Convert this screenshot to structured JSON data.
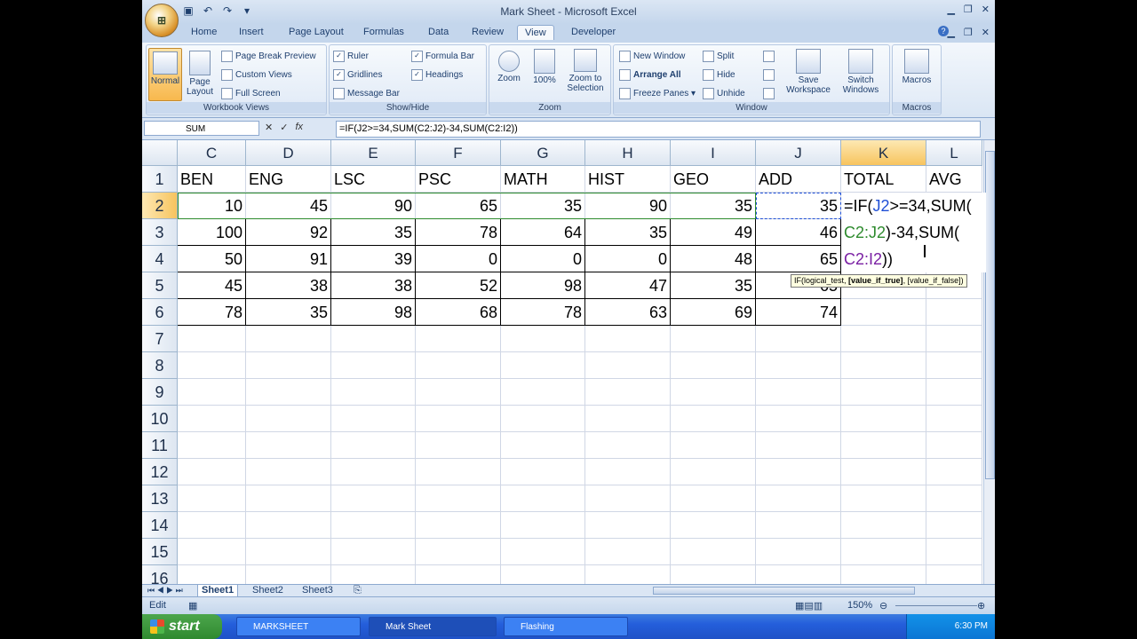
{
  "window": {
    "title": "Mark Sheet - Microsoft Excel",
    "qat_icons": [
      "save-icon",
      "undo-icon",
      "redo-icon",
      "customize-qat-icon"
    ],
    "controls": [
      "minimize",
      "restore",
      "close"
    ]
  },
  "tabs": [
    "Home",
    "Insert",
    "Page Layout",
    "Formulas",
    "Data",
    "Review",
    "View",
    "Developer"
  ],
  "active_tab": "View",
  "ribbon": {
    "workbook_views": {
      "label": "Workbook Views",
      "normal": "Normal",
      "page_layout": "Page Layout",
      "page_break_preview": "Page Break Preview",
      "custom_views": "Custom Views",
      "full_screen": "Full Screen"
    },
    "show_hide": {
      "label": "Show/Hide",
      "ruler": "Ruler",
      "gridlines": "Gridlines",
      "message_bar": "Message Bar",
      "formula_bar": "Formula Bar",
      "headings": "Headings",
      "ruler_checked": true,
      "gridlines_checked": true,
      "message_bar_checked": false,
      "formula_bar_checked": true,
      "headings_checked": true
    },
    "zoom": {
      "label": "Zoom",
      "zoom": "Zoom",
      "hundred": "100%",
      "zoom_to_selection": "Zoom to Selection"
    },
    "window": {
      "label": "Window",
      "new_window": "New Window",
      "arrange_all": "Arrange All",
      "freeze_panes": "Freeze Panes",
      "split": "Split",
      "hide": "Hide",
      "unhide": "Unhide",
      "save_workspace": "Save Workspace",
      "switch_windows": "Switch Windows"
    },
    "macros": {
      "label": "Macros",
      "macros": "Macros"
    }
  },
  "formula_bar": {
    "name_box": "SUM",
    "formula": "=IF(J2>=34,SUM(C2:J2)-34,SUM(C2:I2))"
  },
  "columns": [
    "C",
    "D",
    "E",
    "F",
    "G",
    "H",
    "I",
    "J",
    "K",
    "L"
  ],
  "selected_column": "K",
  "selected_row": "2",
  "rows": [
    "1",
    "2",
    "3",
    "4",
    "5",
    "6",
    "7",
    "8",
    "9",
    "10",
    "11",
    "12",
    "13",
    "14",
    "15",
    "16"
  ],
  "headers": [
    "BEN",
    "ENG",
    "LSC",
    "PSC",
    "MATH",
    "HIST",
    "GEO",
    "ADD",
    "TOTAL",
    "AVG"
  ],
  "data": [
    [
      "10",
      "45",
      "90",
      "65",
      "35",
      "90",
      "35",
      "35"
    ],
    [
      "100",
      "92",
      "35",
      "78",
      "64",
      "35",
      "49",
      "46"
    ],
    [
      "50",
      "91",
      "39",
      "0",
      "0",
      "0",
      "48",
      "65"
    ],
    [
      "45",
      "38",
      "38",
      "52",
      "98",
      "47",
      "35",
      "65"
    ],
    [
      "78",
      "35",
      "98",
      "68",
      "78",
      "63",
      "69",
      "74"
    ]
  ],
  "edit_cell": {
    "line1_prefix": "=IF(",
    "line1_ref": "J2",
    "line1_rest": ">=34,SUM(",
    "line2_ref": "C2:J2",
    "line2_rest": ")-34,SUM(",
    "line3_ref": "C2:I2",
    "line3_rest": "))",
    "colors": {
      "ref1": "#1f4fd6",
      "ref2": "#2e8b2e",
      "ref3": "#7a1fa3"
    }
  },
  "tooltip": {
    "fn": "IF(logical_test, ",
    "bold": "[value_if_true]",
    "rest": ", [value_if_false])"
  },
  "sheets": [
    "Sheet1",
    "Sheet2",
    "Sheet3"
  ],
  "active_sheet": "Sheet1",
  "status": {
    "mode": "Edit",
    "zoom": "150%"
  },
  "taskbar": {
    "start": "start",
    "tasks": [
      "MARKSHEET",
      "Mark Sheet",
      "Flashing"
    ],
    "active_task": "Mark Sheet",
    "clock": "6:30 PM"
  }
}
